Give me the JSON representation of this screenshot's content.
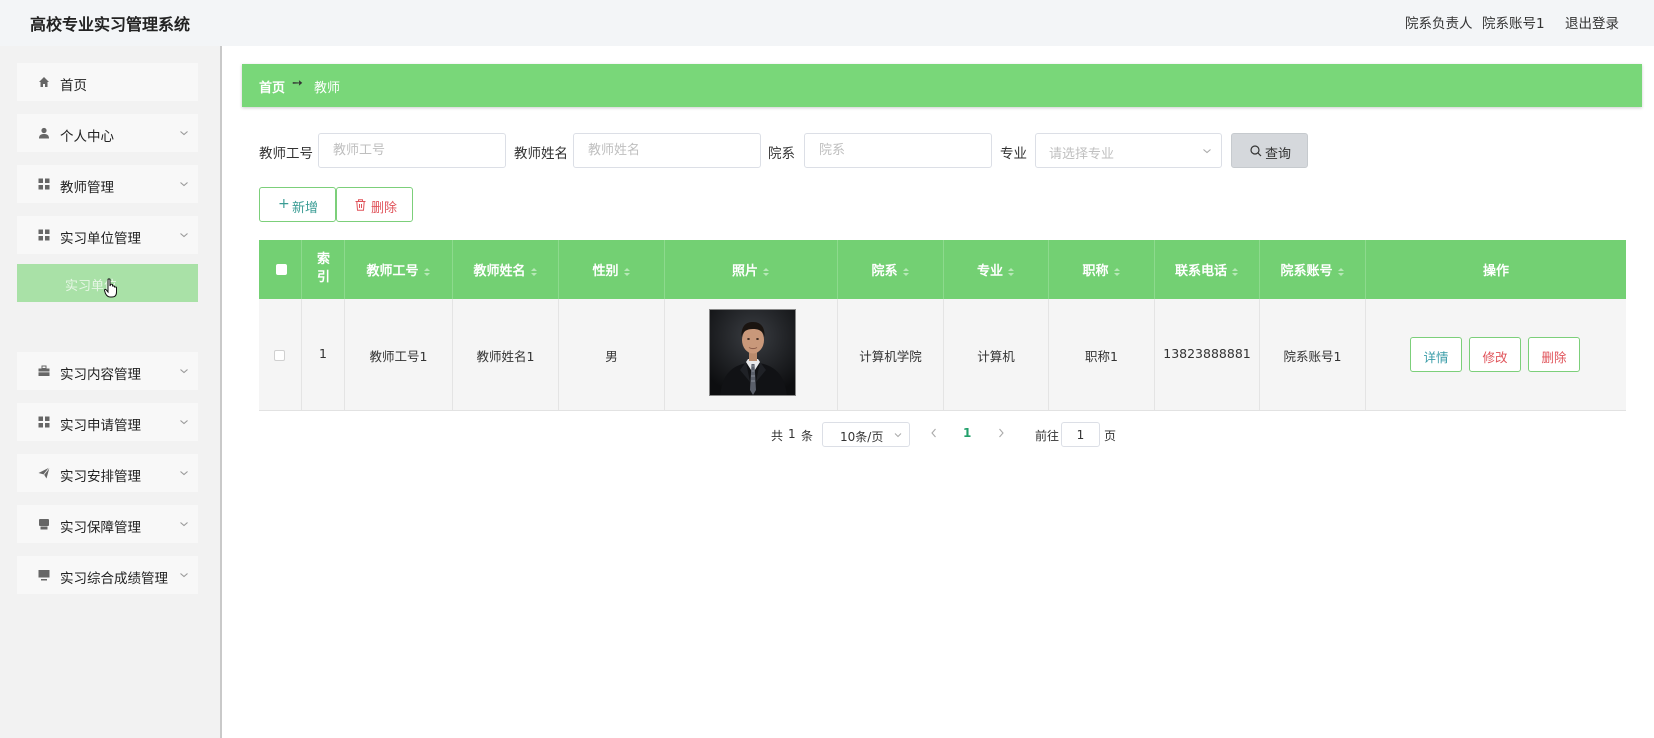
{
  "header": {
    "title": "高校专业实习管理系统",
    "user_role": "院系负责人",
    "user_account": "院系账号1",
    "logout_label": "退出登录"
  },
  "sidebar": {
    "items": [
      {
        "label": "首页",
        "icon": "home-icon"
      },
      {
        "label": "个人中心",
        "icon": "user-icon"
      },
      {
        "label": "教师管理",
        "icon": "grid-icon"
      },
      {
        "label": "实习单位管理",
        "icon": "grid-icon"
      },
      {
        "label": "实习内容管理",
        "icon": "briefcase-icon"
      },
      {
        "label": "实习申请管理",
        "icon": "grid-icon"
      },
      {
        "label": "实习安排管理",
        "icon": "send-icon"
      },
      {
        "label": "实习保障管理",
        "icon": "printer-icon"
      },
      {
        "label": "实习综合成绩管理",
        "icon": "monitor-icon"
      }
    ],
    "active_subitem": "实习单位"
  },
  "breadcrumb": {
    "home": "首页",
    "separator": "➙",
    "current": "教师"
  },
  "filters": {
    "teacher_id_label": "教师工号",
    "teacher_id_placeholder": "教师工号",
    "teacher_name_label": "教师姓名",
    "teacher_name_placeholder": "教师姓名",
    "department_label": "院系",
    "department_placeholder": "院系",
    "major_label": "专业",
    "major_placeholder": "请选择专业",
    "search_label": "查询"
  },
  "actions": {
    "add_label": "新增",
    "delete_label": "删除"
  },
  "table": {
    "columns": [
      "索引",
      "教师工号",
      "教师姓名",
      "性别",
      "照片",
      "院系",
      "专业",
      "职称",
      "联系电话",
      "院系账号",
      "操作"
    ],
    "rows": [
      {
        "index": "1",
        "teacher_id": "教师工号1",
        "teacher_name": "教师姓名1",
        "gender": "男",
        "department": "计算机学院",
        "major": "计算机",
        "title": "职称1",
        "phone": "13823888881",
        "dept_account": "院系账号1",
        "op_detail": "详情",
        "op_edit": "修改",
        "op_delete": "删除"
      }
    ]
  },
  "pagination": {
    "total_prefix": "共",
    "total": "1",
    "total_suffix": "条",
    "page_size": "10条/页",
    "current_page": "1",
    "goto_prefix": "前往",
    "goto_value": "1",
    "goto_suffix": "页"
  },
  "colors": {
    "accent_green": "#79d779",
    "table_header": "#73d073",
    "active_submenu": "#a9e1a7",
    "danger": "#e0535a",
    "teal": "#3a9c94"
  }
}
